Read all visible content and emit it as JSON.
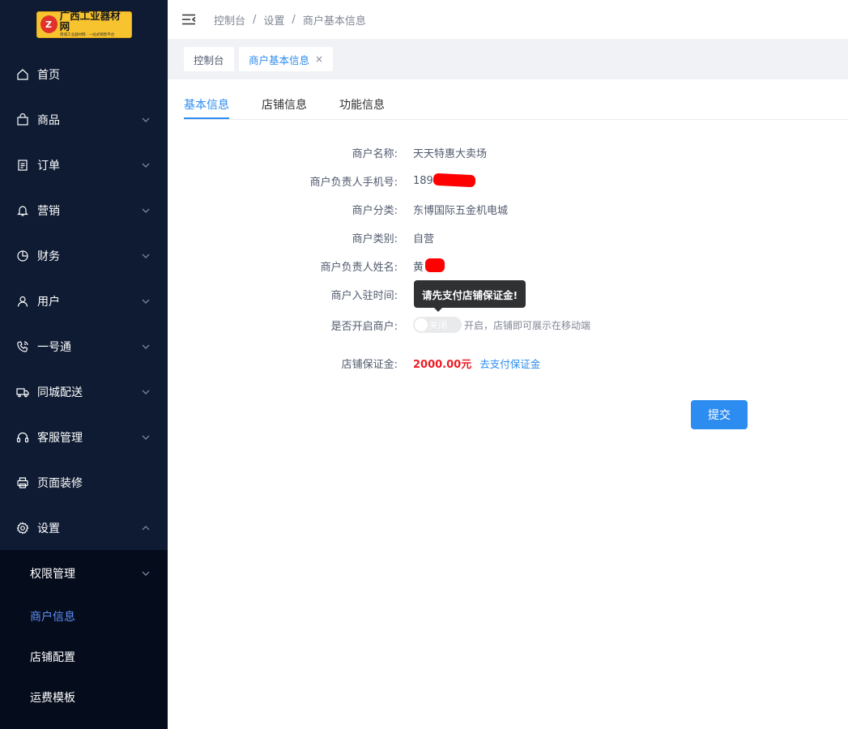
{
  "logo": {
    "title": "广西工业器材网",
    "subtitle": "南城工业器材网 · 一站式销售平台",
    "mark": "Z"
  },
  "sidebar": {
    "items": [
      {
        "label": "首页",
        "icon": "home-icon",
        "has_children": false
      },
      {
        "label": "商品",
        "icon": "shopping-bag-icon",
        "has_children": true
      },
      {
        "label": "订单",
        "icon": "document-icon",
        "has_children": true
      },
      {
        "label": "营销",
        "icon": "bell-icon",
        "has_children": true
      },
      {
        "label": "财务",
        "icon": "pie-chart-icon",
        "has_children": true
      },
      {
        "label": "用户",
        "icon": "user-icon",
        "has_children": true
      },
      {
        "label": "一号通",
        "icon": "phone-icon",
        "has_children": true
      },
      {
        "label": "同城配送",
        "icon": "truck-icon",
        "has_children": true
      },
      {
        "label": "客服管理",
        "icon": "headset-icon",
        "has_children": true
      },
      {
        "label": "页面装修",
        "icon": "printer-icon",
        "has_children": false
      },
      {
        "label": "设置",
        "icon": "gear-icon",
        "has_children": true,
        "expanded": true
      }
    ],
    "sub_items": [
      {
        "label": "权限管理",
        "has_children": true
      },
      {
        "label": "商户信息",
        "active": true
      },
      {
        "label": "店铺配置"
      },
      {
        "label": "运费模板"
      }
    ]
  },
  "header": {
    "breadcrumb": [
      "控制台",
      "设置",
      "商户基本信息"
    ],
    "separator": "/"
  },
  "tags": [
    {
      "label": "控制台"
    },
    {
      "label": "商户基本信息",
      "active": true,
      "close": "×"
    }
  ],
  "tabs": [
    "基本信息",
    "店铺信息",
    "功能信息"
  ],
  "form": {
    "name_label": "商户名称:",
    "name_value": "天天特惠大卖场",
    "phone_label": "商户负责人手机号:",
    "phone_value": "1897",
    "category_label": "商户分类:",
    "category_value": "东博国际五金机电城",
    "type_label": "商户类别:",
    "type_value": "自营",
    "contact_label": "商户负责人姓名:",
    "contact_value": "黄",
    "join_time_label": "商户入驻时间:",
    "open_label": "是否开启商户:",
    "switch_text": "关闭",
    "switch_on": false,
    "switch_tip": "开启，店铺即可展示在移动端",
    "deposit_label": "店铺保证金:",
    "deposit_value": "2000.00元",
    "pay_link": "去支付保证金"
  },
  "tooltip": "请先支付店铺保证金!",
  "submit_label": "提交",
  "colors": {
    "sidebar_bg": "#0e1b33",
    "submenu_bg": "#050c1c",
    "primary": "#2d8cf0",
    "active_submenu": "#5d8ff6",
    "deposit": "#ed1c24"
  }
}
